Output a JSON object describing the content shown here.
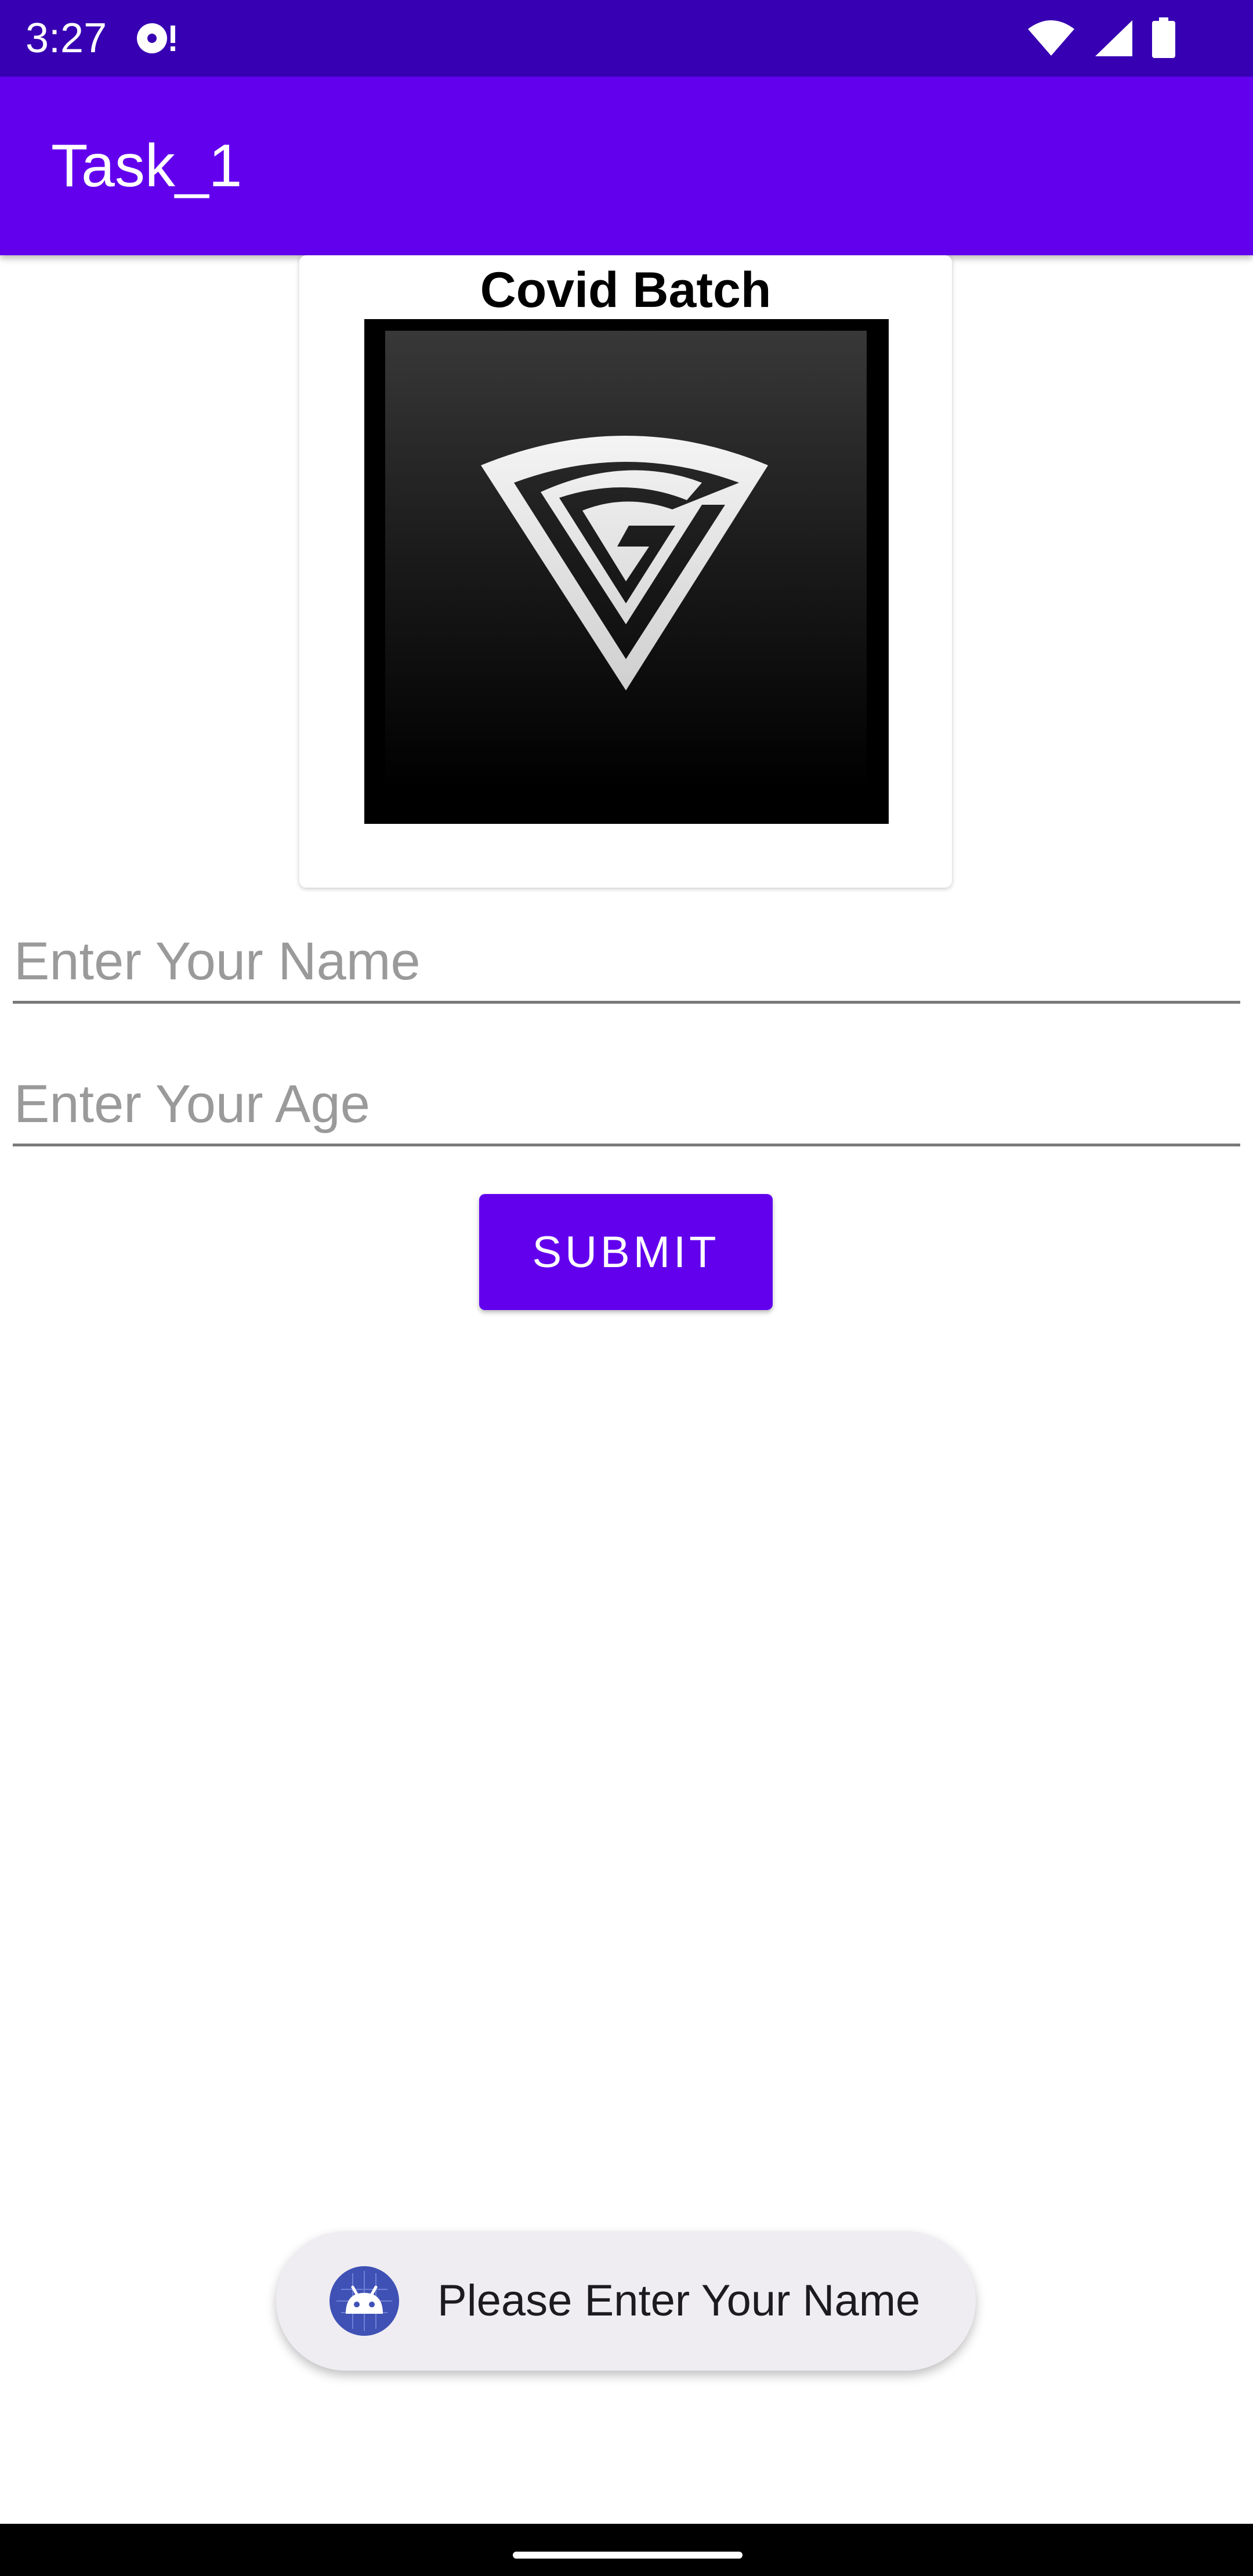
{
  "status_bar": {
    "time": "3:27",
    "icons": [
      "media-notification-icon",
      "wifi-icon",
      "cellular-signal-icon",
      "battery-icon"
    ],
    "background": "#3700B3"
  },
  "app_bar": {
    "title": "Task_1",
    "background": "#6200EE"
  },
  "card": {
    "title": "Covid Batch",
    "logo": "shield-logo"
  },
  "form": {
    "name_placeholder": "Enter Your Name",
    "name_value": "",
    "age_placeholder": "Enter Your Age",
    "age_value": "",
    "submit_label": "SUBMIT",
    "accent": "#6200EE"
  },
  "toast": {
    "icon": "android-icon",
    "message": "Please Enter Your Name"
  }
}
